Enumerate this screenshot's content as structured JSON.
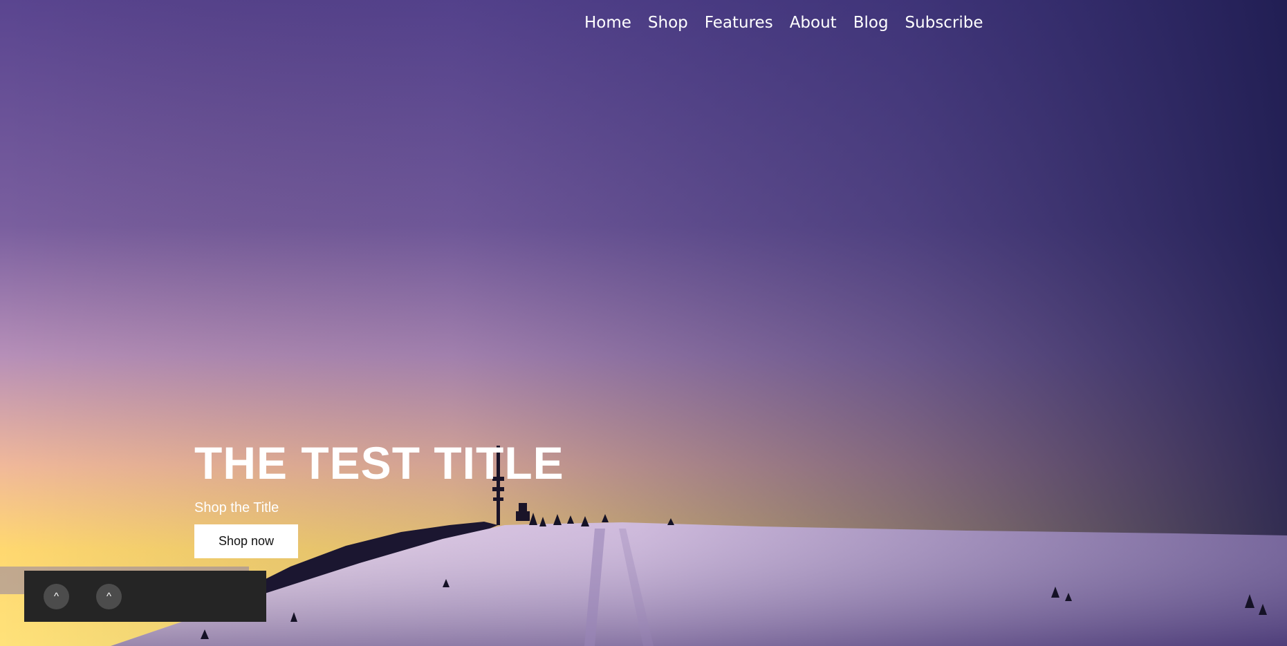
{
  "nav": {
    "items": [
      {
        "label": "Home"
      },
      {
        "label": "Shop"
      },
      {
        "label": "Features"
      },
      {
        "label": "About"
      },
      {
        "label": "Blog"
      },
      {
        "label": "Subscribe"
      }
    ]
  },
  "hero": {
    "title": "THE TEST TITLE",
    "subtitle": "Shop the Title",
    "cta_label": "Shop now"
  },
  "toolbar": {
    "button_1_label": "^",
    "button_2_label": "^"
  },
  "colors": {
    "sky_top": "#4b3b86",
    "sky_mid": "#b08ab5",
    "horizon": "#ffd86a",
    "snow": "#c9b4d9",
    "toolbar_bg": "#252525"
  }
}
